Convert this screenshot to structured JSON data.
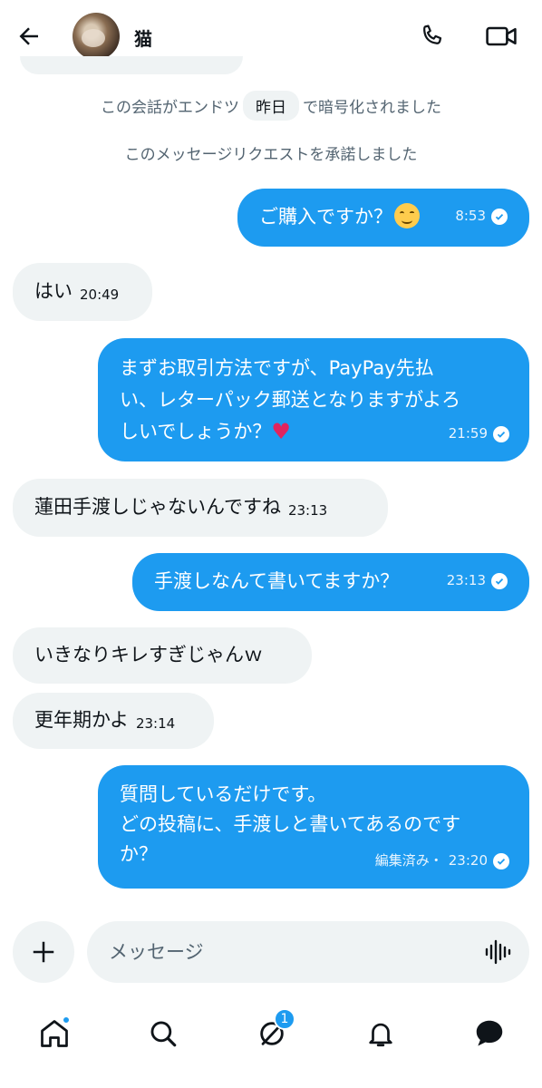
{
  "header": {
    "contact_name": "猫",
    "avatar_icon": "cat-avatar"
  },
  "system_notes": {
    "encryption_pre": "この会話がエンドツ",
    "encryption_chip": "昨日",
    "encryption_post": "で暗号化されました",
    "request_accepted": "このメッセージリクエストを承諾しました"
  },
  "messages": [
    {
      "dir": "out",
      "text": "ご購入ですか？",
      "emoji": "smiling-face",
      "time": "8:53",
      "status": "read"
    },
    {
      "dir": "in",
      "text": "はい",
      "time": "20:49"
    },
    {
      "dir": "out",
      "lines": [
        "まずお取引方法ですが、PayPay先払",
        "い、レターパック郵送となりますがよろ",
        "しいでしょうか？"
      ],
      "emoji": "red-heart",
      "time": "21:59",
      "status": "read"
    },
    {
      "dir": "in",
      "text": "蓮田手渡しじゃないんですね",
      "time": "23:13"
    },
    {
      "dir": "out",
      "text": "手渡しなんて書いてますか？",
      "time": "23:13",
      "status": "read"
    },
    {
      "dir": "in",
      "text": "いきなりキレすぎじゃんｗ"
    },
    {
      "dir": "in",
      "text": "更年期かよ",
      "time": "23:14"
    },
    {
      "dir": "out",
      "lines": [
        "質問しているだけです。",
        "どの投稿に、手渡しと書いてあるのです",
        "か？"
      ],
      "edited": "編集済み・",
      "time": "23:20",
      "status": "read"
    }
  ],
  "composer": {
    "placeholder": "メッセージ"
  },
  "nav": {
    "grok_badge": "1"
  },
  "colors": {
    "accent": "#1d9bf0",
    "incoming_bubble": "#eff3f4",
    "secondary_text": "#536471"
  }
}
